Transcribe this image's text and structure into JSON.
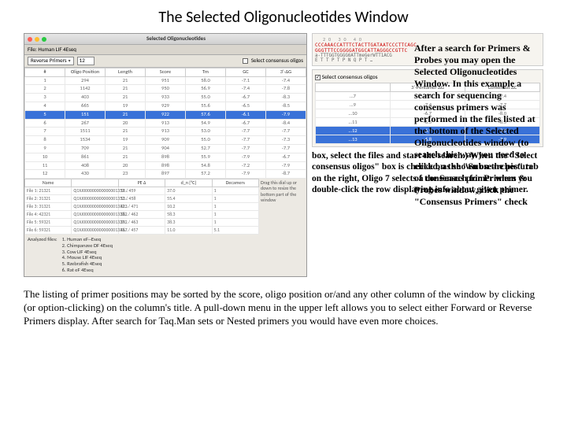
{
  "page_title": "The Selected Oligonucleotides Window",
  "window": {
    "title": "Selected Oligonucleotides",
    "subtitle": "File: Human LIF 4Eseq",
    "dropdown": "Reverse Primers",
    "count": "12",
    "consensus_label": "Select consensus oligos",
    "headers": [
      "#",
      "Oligo Position",
      "Length",
      "Score",
      "Tm",
      "GC",
      "3'-ΔG"
    ],
    "rows": [
      [
        "1",
        "294",
        "21",
        "951",
        "58.0",
        "-7.1",
        "-7.4"
      ],
      [
        "2",
        "1142",
        "21",
        "950",
        "56.9",
        "-7.4",
        "-7.8"
      ],
      [
        "3",
        "403",
        "21",
        "933",
        "55.0",
        "-6.7",
        "-8.3"
      ],
      [
        "4",
        "665",
        "19",
        "929",
        "55.6",
        "-6.5",
        "-8.5"
      ],
      [
        "5",
        "151",
        "21",
        "922",
        "57.6",
        "-6.1",
        "-7.9"
      ],
      [
        "6",
        "267",
        "20",
        "913",
        "54.9",
        "-6.7",
        "-8.4"
      ],
      [
        "7",
        "1511",
        "21",
        "913",
        "53.0",
        "-7.7",
        "-7.7"
      ],
      [
        "8",
        "1534",
        "19",
        "909",
        "55.0",
        "-7.7",
        "-7.3"
      ],
      [
        "9",
        "709",
        "21",
        "904",
        "52.7",
        "-7.7",
        "-7.7"
      ],
      [
        "10",
        "861",
        "21",
        "898",
        "55.9",
        "-7.9",
        "-6.7"
      ],
      [
        "11",
        "408",
        "20",
        "898",
        "54.8",
        "-7.2",
        "-7.9"
      ],
      [
        "12",
        "430",
        "23",
        "897",
        "57.2",
        "-7.9",
        "-8.7"
      ]
    ],
    "drag_hint": "Drag this dial up or down to resize the bottom part of the window",
    "file_headers": [
      "Name",
      "",
      "PE Δ",
      "d_n [°C]",
      "Decamers"
    ],
    "file_rows": [
      [
        "File 1: 21321",
        "Q1XJ000000000000001332…",
        "59 / 459",
        "37.0",
        "1"
      ],
      [
        "File 2: 31321",
        "Q1XJ000000000000001332…",
        "53 / 458",
        "55.4",
        "1"
      ],
      [
        "File 3: 31321",
        "Q1XJ000000000000001332…",
        "423 / 471",
        "10.2",
        "1"
      ],
      [
        "File 4: 42321",
        "Q1XJ000000000000001333…",
        "382 / 462",
        "58.3",
        "1"
      ],
      [
        "File 5: 59321",
        "Q1XJ000000000000001333…",
        "392 / 463",
        "38.3",
        "1"
      ],
      [
        "File 6: 59321",
        "Q1XJ000000000000001333…",
        "467 / 457",
        "11.0",
        "5.1"
      ]
    ],
    "analyzed_label": "Analyzed files:",
    "analyzed_files": [
      "1. Human eF--Eseq",
      "2. Chimpanzee DF 4Eseq",
      "3. Cow LIF 4Eseq",
      "4. Mouse LIF 4Eseq",
      "5. Rzebrafish 4Eseq",
      "6. Rat eF 4Eseq"
    ]
  },
  "snippet": {
    "ruler": "20       30       40",
    "seq1": "CCCAAACCATTTCTACTTGATAATCCCTTCAGC",
    "seq2": "GGGTTTCCGGGGATGGCATTAGGGCCGTTC",
    "translate": "E  T  T  P  T  P  N  Q  P  T  …",
    "mono": "a-TTTGGTGGGG6ATTmeGerWTT1ACG",
    "consensus_label": "Select consensus oligos",
    "tab_headers": [
      "",
      "3'-Pentamer ΔG",
      "Consensus ΔC"
    ],
    "tab_rows": [
      [
        "…7",
        "-7.1",
        "-7.4"
      ],
      [
        "…9",
        "-7.4",
        "-7.7"
      ],
      [
        "…10",
        "-6.7",
        "-8.0"
      ],
      [
        "…11",
        "-6.5",
        "-8.5"
      ],
      [
        "…12",
        "-6.9",
        "-8.5"
      ],
      [
        "…13",
        "-6.8",
        "-7.9"
      ]
    ]
  },
  "para1": "After a search for Primers & Probes you may open the Selected Oligonucleotides Window. In this example a search for sequencing consensus primers was performed in the files listed at the bottom of the Selected Oligonucleotides window (to search this way you need to click on the \"Subsearches\" tab of the Search for Primers & Probes window, click the \"Consensus Primers\" check box, select the files and start the search.) When the \"Select consensus oligos\" box is checked, as shown on the picture on the right, Oligo 7 selects a consensus primer when you double-click the row displaying info about given primer.",
  "para2": "The listing of primer positions may be sorted by the score, oligo position or/and any other column of the window by clicking (or option-clicking) on the column's title. A pull-down menu in the upper left allows you to select either Forward or Reverse Primers display. After search for Taq.Man sets or Nested primers you would have even more choices."
}
